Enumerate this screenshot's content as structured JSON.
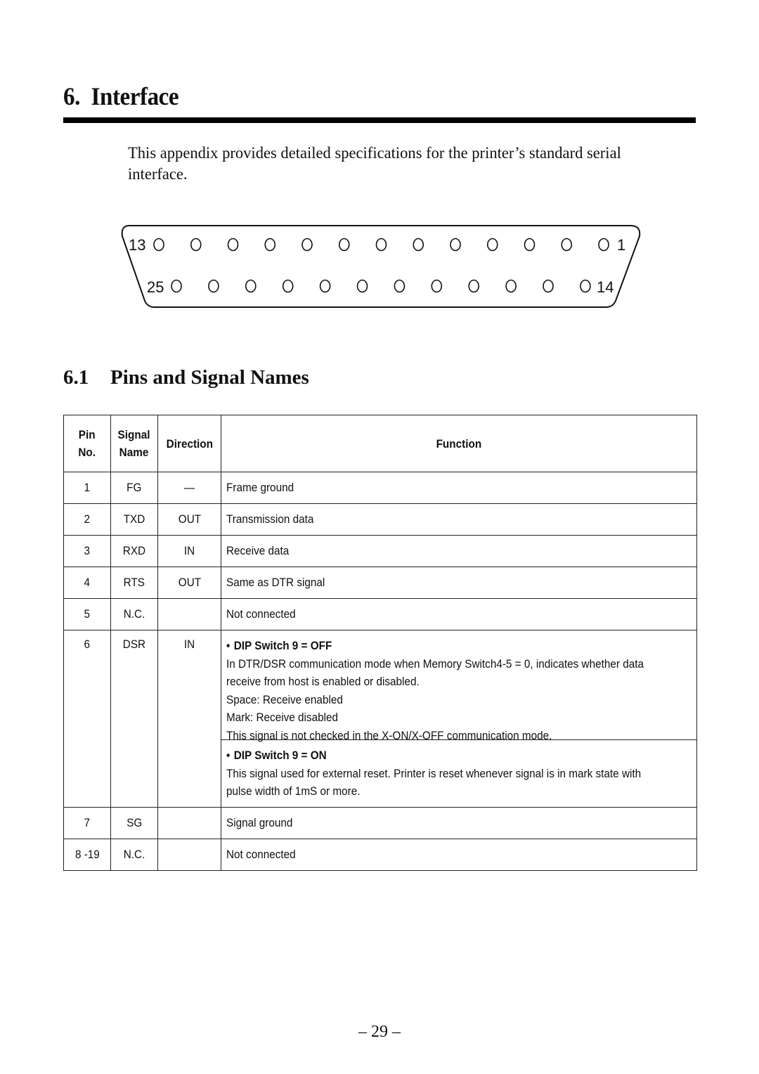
{
  "chapter": {
    "number": "6.",
    "title": "Interface"
  },
  "intro": "This appendix provides detailed specifications for the printer’s standard serial interface.",
  "connector": {
    "type": "DB-25",
    "top_row": {
      "left_label": "13",
      "right_label": "1",
      "pin_count": 13
    },
    "bottom_row": {
      "left_label": "25",
      "right_label": "14",
      "pin_count": 12
    }
  },
  "section": {
    "number": "6.1",
    "title": "Pins and Signal Names"
  },
  "table": {
    "headers": {
      "pin_line1": "Pin",
      "pin_line2": "No.",
      "signal_line1": "Signal",
      "signal_line2": "Name",
      "direction": "Direction",
      "function": "Function"
    },
    "rows": [
      {
        "pin": "1",
        "signal": "FG",
        "direction": "—",
        "function": "Frame ground"
      },
      {
        "pin": "2",
        "signal": "TXD",
        "direction": "OUT",
        "function": "Transmission data"
      },
      {
        "pin": "3",
        "signal": "RXD",
        "direction": "IN",
        "function": "Receive data"
      },
      {
        "pin": "4",
        "signal": "RTS",
        "direction": "OUT",
        "function": "Same as DTR signal"
      },
      {
        "pin": "5",
        "signal": "N.C.",
        "direction": "",
        "function": "Not connected"
      },
      {
        "pin": "6",
        "signal": "DSR",
        "direction": "IN",
        "conditions": [
          {
            "bullet": "•",
            "heading": "DIP Switch 9 = OFF",
            "lines": [
              "In DTR/DSR communication mode when Memory Switch4-5 = 0, indicates whether data",
              "receive from host is enabled or disabled.",
              "Space: Receive enabled",
              "Mark: Receive disabled",
              "This signal is not checked in the X-ON/X-OFF communication mode."
            ]
          },
          {
            "bullet": "•",
            "heading": "DIP Switch 9 = ON",
            "lines": [
              "This signal used for external reset. Printer is reset whenever signal is in mark state with",
              "pulse width of 1mS or more."
            ]
          }
        ]
      },
      {
        "pin": "7",
        "signal": "SG",
        "direction": "",
        "function": "Signal ground"
      },
      {
        "pin": "8 -19",
        "signal": "N.C.",
        "direction": "",
        "function": "Not connected"
      }
    ]
  },
  "page_number": "– 29 –"
}
